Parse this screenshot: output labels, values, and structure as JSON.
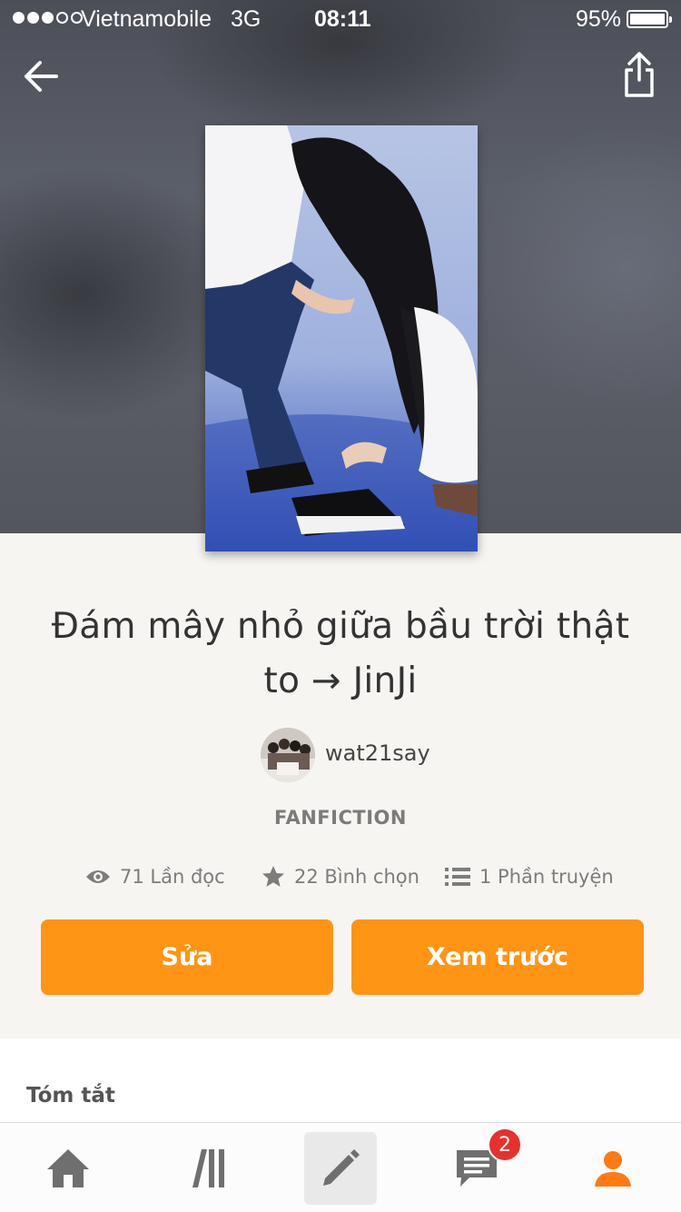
{
  "status_bar": {
    "carrier": "Vietnamobile",
    "network": "3G",
    "time": "08:11",
    "battery": "95%"
  },
  "header": {
    "back_icon": "arrow-left-icon",
    "share_icon": "share-icon"
  },
  "story": {
    "title": "Đám mây nhỏ giữa bầu trời thật to → JinJi",
    "author": "wat21say",
    "category": "FANFICTION",
    "stats": {
      "reads": "71 Lần đọc",
      "votes": "22 Bình chọn",
      "parts": "1 Phần truyện"
    }
  },
  "actions": {
    "edit_label": "Sửa",
    "preview_label": "Xem trước"
  },
  "summary": {
    "heading": "Tóm tắt"
  },
  "tabbar": {
    "items": [
      "home-icon",
      "library-icon",
      "pencil-icon",
      "messages-icon",
      "profile-icon"
    ],
    "messages_badge": "2"
  },
  "colors": {
    "accent": "#ff9415",
    "badge": "#e8302c",
    "page_bg": "#f6f5f2"
  }
}
